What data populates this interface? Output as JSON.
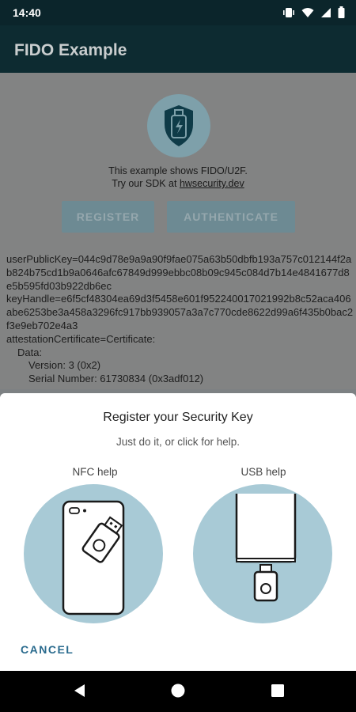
{
  "status_bar": {
    "time": "14:40"
  },
  "app_bar": {
    "title": "FIDO Example"
  },
  "intro": {
    "line1": "This example shows FIDO/U2F.",
    "line2_prefix": "Try our SDK at ",
    "link": "hwsecurity.dev"
  },
  "buttons": {
    "register": "REGISTER",
    "authenticate": "AUTHENTICATE"
  },
  "log_lines": [
    "userPublicKey=044c9d78e9a9a90f9fae075a63b50dbfb193a757c012144f2ab824b75cd1b9a0646afc67849d999ebbc08b09c945c084d7b14e4841677d8e5b595fd03b922db6ec",
    "keyHandle=e6f5cf48304ea69d3f5458e601f952240017021992b8c52aca406abe6253be3a458a3296fc917bb939057a3a7c770cde8622d99a6f435b0bac2f3e9eb702e4a3",
    "attestationCertificate=Certificate:",
    "Data:",
    "Version: 3 (0x2)",
    "Serial Number: 61730834 (0x3adf012)"
  ],
  "sheet": {
    "title": "Register your Security Key",
    "subtitle": "Just do it, or click for help.",
    "nfc_help": "NFC help",
    "usb_help": "USB help",
    "cancel": "CANCEL"
  },
  "colors": {
    "accent": "#2a6b8e",
    "illustration_circle": "#a8cad6",
    "app_bar": "#0d2b31"
  },
  "icons": {
    "status": [
      "vibrate-icon",
      "wifi-icon",
      "signal-icon",
      "battery-icon"
    ],
    "nav": [
      "back-icon",
      "home-icon",
      "recents-icon"
    ]
  }
}
